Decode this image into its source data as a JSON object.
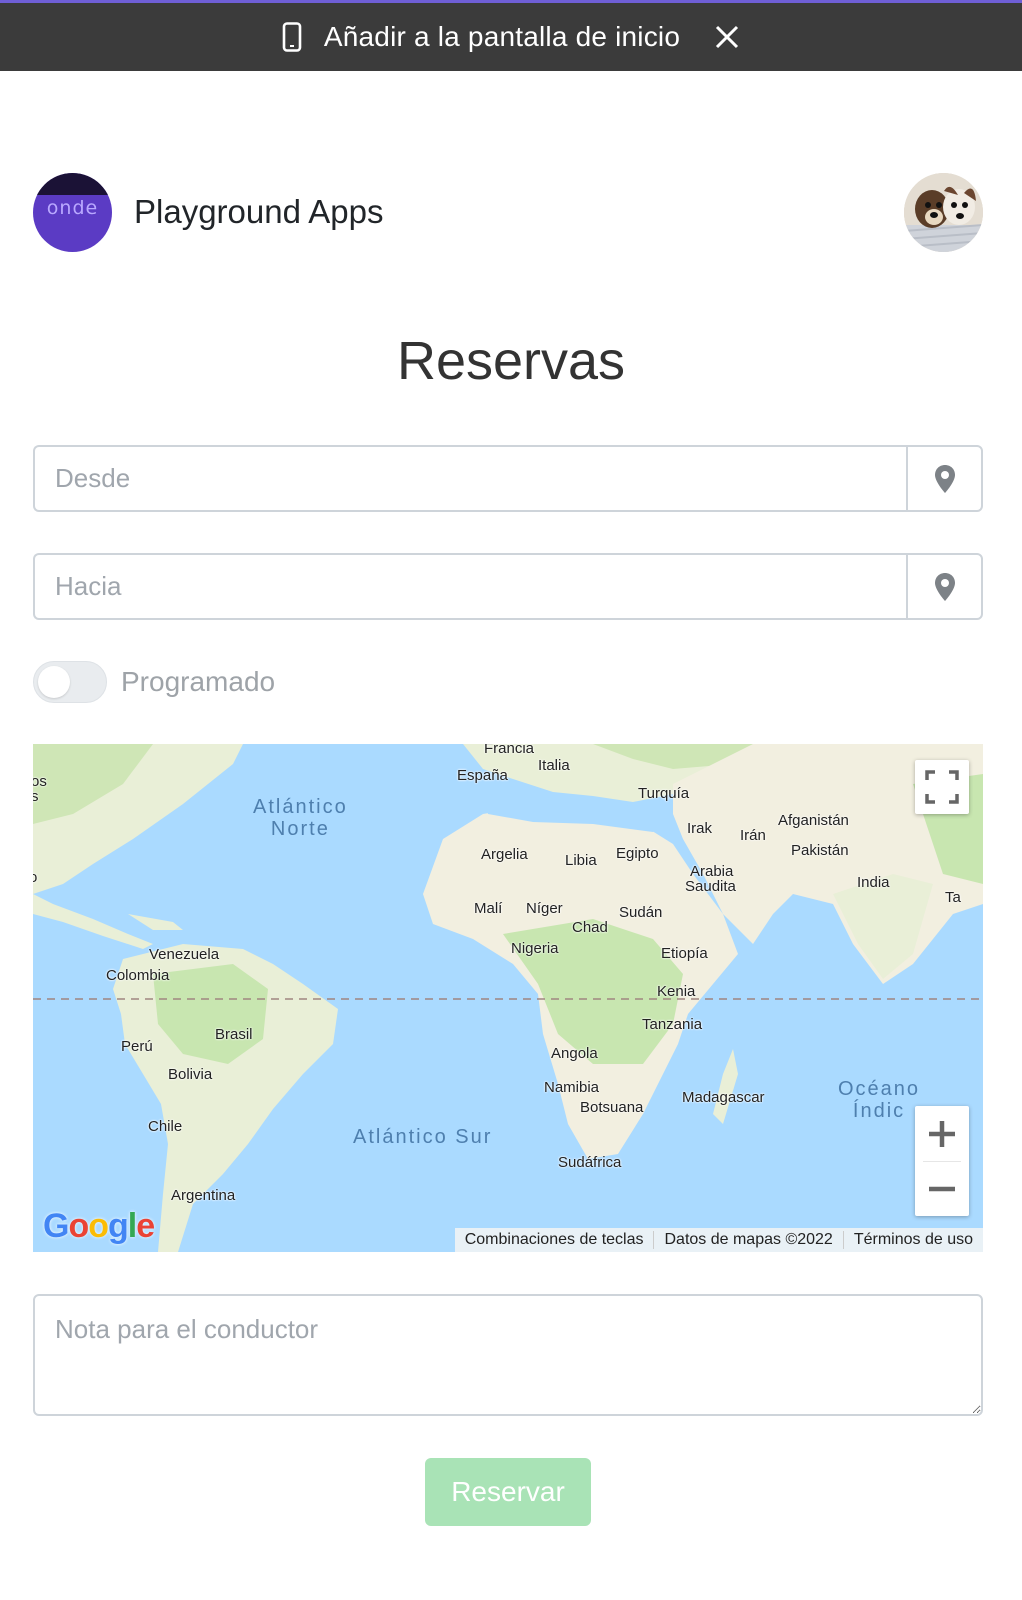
{
  "banner": {
    "text": "Añadir a la pantalla de inicio",
    "phone_icon": "phone-icon",
    "close_icon": "close-icon"
  },
  "header": {
    "logo_text": "onde",
    "app_name": "Playground Apps",
    "avatar": "user-avatar"
  },
  "page": {
    "title": "Reservas"
  },
  "form": {
    "from_placeholder": "Desde",
    "to_placeholder": "Hacia",
    "location_icon": "map-pin-icon",
    "scheduled_label": "Programado",
    "scheduled_on": false,
    "note_placeholder": "Nota para el conductor",
    "submit_label": "Reservar"
  },
  "map": {
    "oceans": {
      "north_atlantic_line1": "Atlántico",
      "north_atlantic_line2": "Norte",
      "south_atlantic": "Atlántico Sur",
      "indian_line1": "Océano",
      "indian_line2": "Índic"
    },
    "countries": {
      "francia": "Francia",
      "italia": "Italia",
      "espana": "España",
      "turquia": "Turquía",
      "afganistan": "Afganistán",
      "irak": "Irak",
      "iran": "Irán",
      "pakistan": "Pakistán",
      "argelia": "Argelia",
      "libia": "Libia",
      "egipto": "Egipto",
      "arabia_1": "Arabia",
      "arabia_2": "Saudita",
      "india": "India",
      "ta": "Ta",
      "mali": "Malí",
      "niger": "Níger",
      "sudan": "Sudán",
      "chad": "Chad",
      "nigeria": "Nigeria",
      "etiopia": "Etiopía",
      "venezuela": "Venezuela",
      "colombia": "Colombia",
      "kenia": "Kenia",
      "tanzania": "Tanzania",
      "peru": "Perú",
      "brasil": "Brasil",
      "angola": "Angola",
      "bolivia": "Bolivia",
      "namibia": "Namibia",
      "botsuana": "Botsuana",
      "madagascar": "Madagascar",
      "chile": "Chile",
      "sudafrica": "Sudáfrica",
      "argentina": "Argentina",
      "edge_os1": "os",
      "edge_os2": "s",
      "edge_o": "o"
    },
    "google_logo": "Google",
    "attribution": {
      "shortcuts": "Combinaciones de teclas",
      "data": "Datos de mapas ©2022",
      "terms": "Términos de uso"
    },
    "fullscreen_icon": "fullscreen-icon",
    "zoom_in_icon": "zoom-in-icon",
    "zoom_out_icon": "zoom-out-icon"
  },
  "colors": {
    "banner_bg": "#3b3b3b",
    "banner_accent": "#6f5fd6",
    "logo_bg": "#5b3bc4",
    "submit_bg": "#a9e3b6",
    "water": "#aadaff",
    "land": "#f2efe0",
    "vegetation": "#c8e6b0"
  }
}
